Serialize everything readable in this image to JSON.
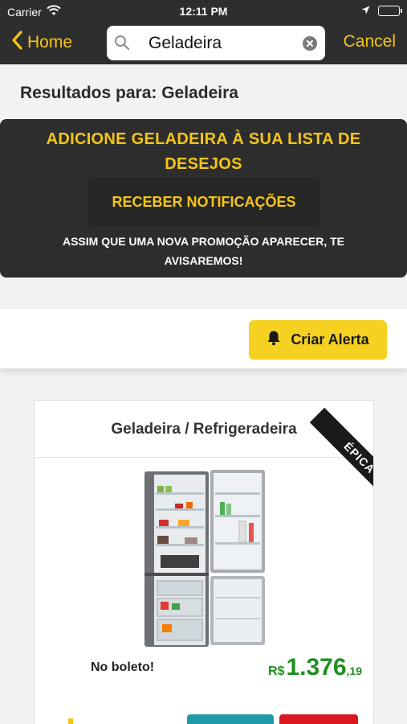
{
  "status_bar": {
    "carrier": "Carrier",
    "time": "12:11 PM"
  },
  "nav": {
    "back_label": "Home",
    "search_value": "Geladeira",
    "cancel_label": "Cancel"
  },
  "results": {
    "title": "Resultados para: Geladeira"
  },
  "wishlist": {
    "headline": "ADICIONE  GELADEIRA  À SUA LISTA DE DESEJOS",
    "notify_button": "RECEBER NOTIFICAÇÕES",
    "note": "ASSIM QUE UMA NOVA PROMOÇÃO APARECER, TE AVISAREMOS!"
  },
  "alert": {
    "button_label": "Criar Alerta"
  },
  "product": {
    "title": "Geladeira / Refrigeradeira",
    "badge": "ÉPICA",
    "payment_note": "No boleto!",
    "price_currency": "R$",
    "price_integer": "1.376",
    "price_cents": ",19"
  },
  "icons": {
    "status": [
      "wifi-icon",
      "location-arrow-icon",
      "battery-icon"
    ],
    "nav": [
      "chevron-left-icon",
      "search-icon",
      "clear-icon"
    ],
    "alert": "bell-icon"
  },
  "colors": {
    "accent": "#f5c518",
    "dark": "#2d2d2d",
    "price_green": "#1f8f1f",
    "alert_yellow": "#f5d221"
  }
}
